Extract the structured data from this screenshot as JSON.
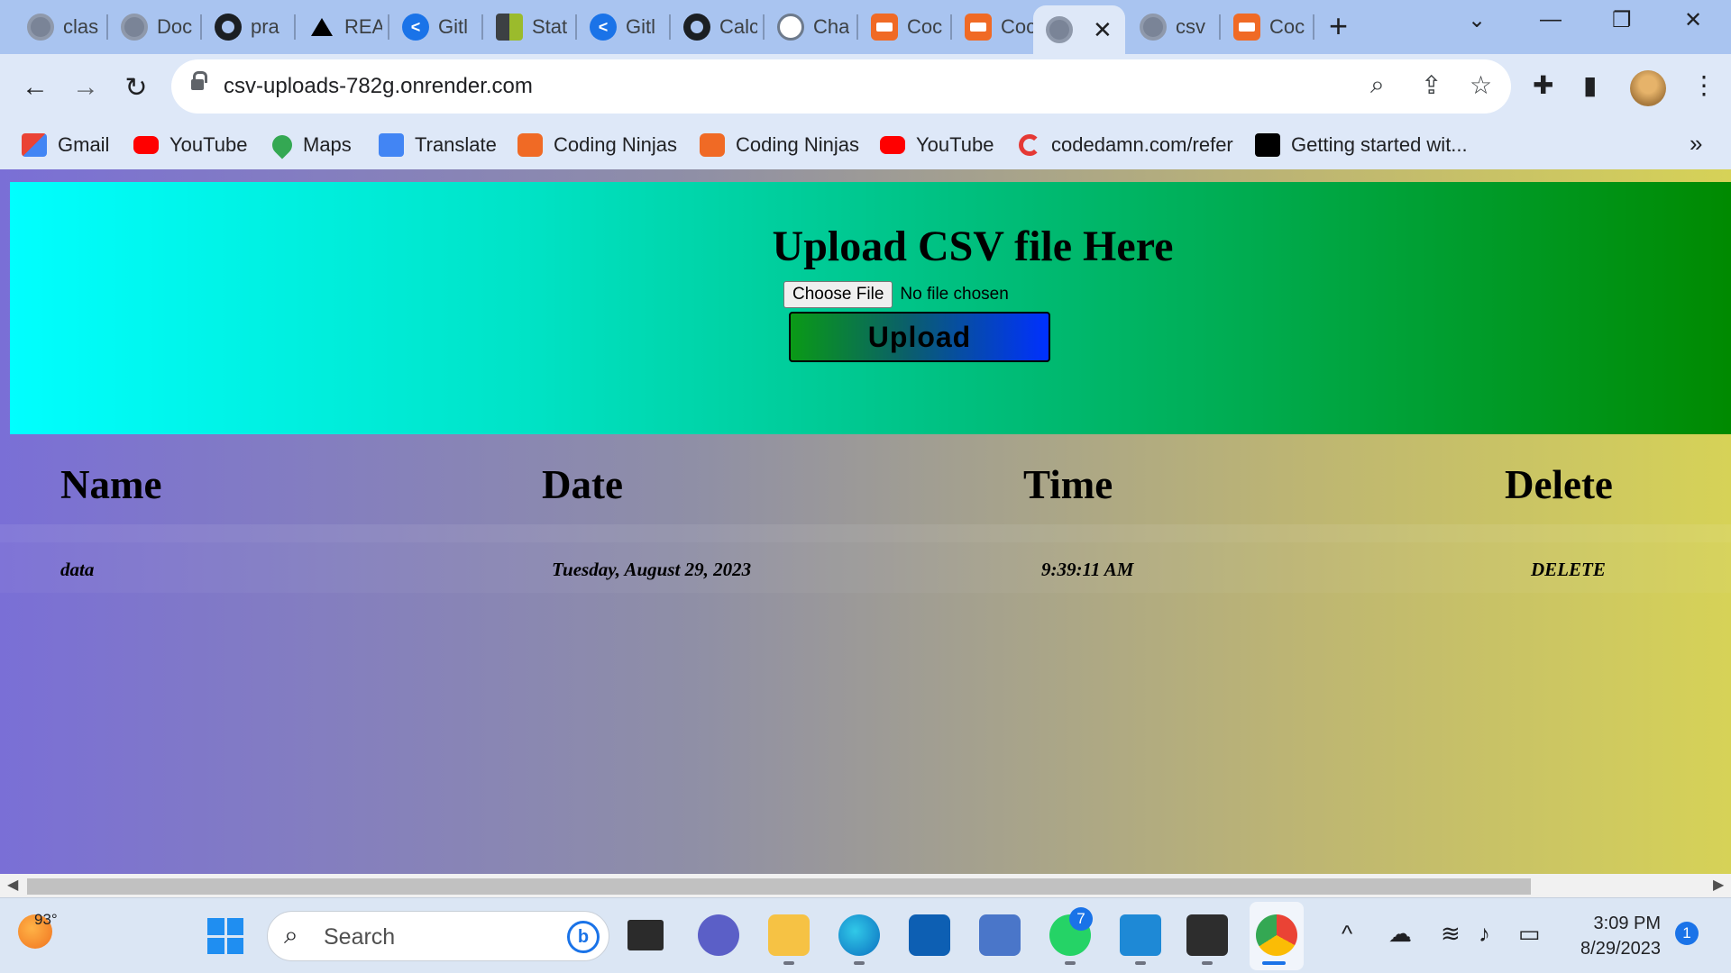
{
  "browser": {
    "tabs": [
      {
        "title": "clas",
        "icon": "globe-icon"
      },
      {
        "title": "Doc",
        "icon": "globe-icon"
      },
      {
        "title": "pra",
        "icon": "github-icon"
      },
      {
        "title": "REA",
        "icon": "vercel-icon"
      },
      {
        "title": "Gitl",
        "icon": "share-icon"
      },
      {
        "title": "Stat",
        "icon": "stat-icon"
      },
      {
        "title": "Gitl",
        "icon": "share-icon"
      },
      {
        "title": "Calc",
        "icon": "github-icon"
      },
      {
        "title": "Cha",
        "icon": "chatgpt-icon"
      },
      {
        "title": "Coc",
        "icon": "coding-ninjas-icon"
      },
      {
        "title": "Coc",
        "icon": "coding-ninjas-icon"
      },
      {
        "title": "",
        "icon": "globe-icon",
        "active": true
      },
      {
        "title": "csv",
        "icon": "globe-icon"
      },
      {
        "title": "Coc",
        "icon": "coding-ninjas-icon"
      }
    ],
    "close_tab_symbol": "✕",
    "new_tab_symbol": "+",
    "url": "csv-uploads-782g.onrender.com",
    "bookmarks": [
      {
        "label": "Gmail",
        "icon": "gmail-icon"
      },
      {
        "label": "YouTube",
        "icon": "youtube-icon"
      },
      {
        "label": "Maps",
        "icon": "maps-icon"
      },
      {
        "label": "Translate",
        "icon": "translate-icon"
      },
      {
        "label": "Coding Ninjas",
        "icon": "coding-ninjas-icon"
      },
      {
        "label": "Coding Ninjas",
        "icon": "coding-ninjas-icon"
      },
      {
        "label": "YouTube",
        "icon": "youtube-icon"
      },
      {
        "label": "codedamn.com/refer",
        "icon": "codedamn-icon"
      },
      {
        "label": "Getting started wit...",
        "icon": "mdn-icon"
      }
    ],
    "bookmarks_more": "»"
  },
  "page": {
    "title": "Upload CSV file Here",
    "choose_file_label": "Choose File",
    "no_file_text": "No file chosen",
    "upload_label": "Upload",
    "table": {
      "headers": {
        "name": "Name",
        "date": "Date",
        "time": "Time",
        "delete": "Delete"
      },
      "rows": [
        {
          "name": "data",
          "date": "Tuesday, August 29, 2023",
          "time": "9:39:11 AM",
          "delete": "DELETE"
        }
      ]
    }
  },
  "taskbar": {
    "temperature": "93°",
    "search_placeholder": "Search",
    "whatsapp_badge": "7",
    "time": "3:09 PM",
    "date": "8/29/2023",
    "notification_count": "1"
  },
  "colors": {
    "accent": "#1a73e8",
    "upload_panel_start": "#00ffff",
    "upload_panel_end": "#008a00",
    "page_bg_start": "#7a6fd6",
    "page_bg_end": "#d6d257"
  }
}
